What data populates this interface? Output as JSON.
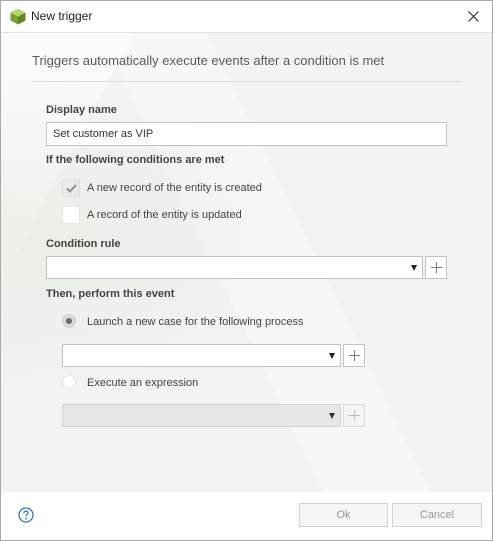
{
  "window": {
    "title": "New trigger"
  },
  "header": {
    "description": "Triggers automatically execute events after a condition is met"
  },
  "form": {
    "display_name": {
      "label": "Display name",
      "value": "Set customer as VIP"
    },
    "conditions": {
      "label": "If the following conditions are met",
      "options": [
        {
          "label": "A new record of the entity is created",
          "checked": true
        },
        {
          "label": "A record of the entity is updated",
          "checked": false
        }
      ]
    },
    "condition_rule": {
      "label": "Condition rule",
      "value": ""
    },
    "event": {
      "label": "Then, perform this event",
      "options": [
        {
          "label": "Launch a new case for the following process",
          "selected": true,
          "value": ""
        },
        {
          "label": "Execute an expression",
          "selected": false,
          "value": ""
        }
      ]
    }
  },
  "footer": {
    "ok_label": "Ok",
    "cancel_label": "Cancel"
  },
  "icons": {
    "app": "cube-icon",
    "close": "close-icon",
    "checkmark": "checkmark-icon",
    "add": "plus-icon",
    "help": "help-icon",
    "dropdown": "caret-down-icon"
  },
  "colors": {
    "app_icon": "#8cb83a",
    "help_icon": "#2e78c2"
  }
}
